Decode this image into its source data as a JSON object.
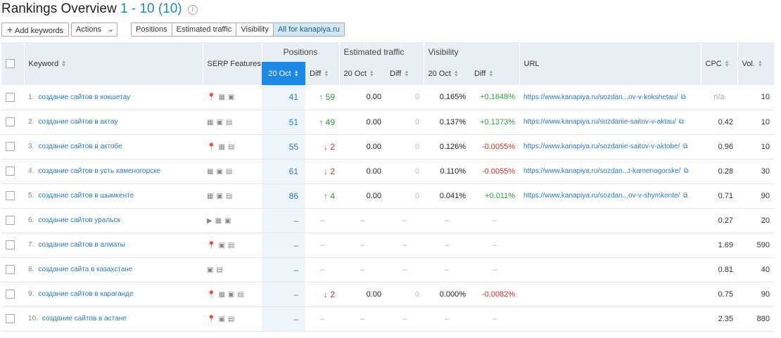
{
  "header": {
    "title": "Rankings Overview",
    "range": "1 - 10 (10)",
    "info_glyph": "i"
  },
  "toolbar": {
    "add_keywords": "Add keywords",
    "actions": "Actions",
    "views": [
      "Positions",
      "Estimated traffic",
      "Visibility",
      "All for kanapiya.ru"
    ],
    "active_view": "All for kanapiya.ru"
  },
  "table": {
    "headers": {
      "keyword": "Keyword",
      "serp": "SERP Features",
      "positions": "Positions",
      "est_traffic": "Estimated traffic",
      "visibility": "Visibility",
      "url": "URL",
      "cpc": "CPC",
      "vol": "Vol.",
      "date": "20 Oct",
      "diff": "Diff"
    },
    "rows": [
      {
        "n": "1.",
        "kw": "создание сайтов в кокшетау",
        "serp": "📍▦▣",
        "pos": "41",
        "pdiff": "↑ 59",
        "pdir": "up",
        "traffic": "0.00",
        "tdiff": "0",
        "vis": "0.165%",
        "vdiff": "+0.1648%",
        "vdir": "up",
        "url": "https://www.kanapiya.ru/sozdan...ov-v-kokshetau/",
        "cpc": "n/a",
        "vol": "10"
      },
      {
        "n": "2.",
        "kw": "создание сайтов в актау",
        "serp": "▦▣▤",
        "pos": "51",
        "pdiff": "↑ 49",
        "pdir": "up",
        "traffic": "0.00",
        "tdiff": "0",
        "vis": "0.137%",
        "vdiff": "+0.1373%",
        "vdir": "up",
        "url": "https://www.kanapiya.ru/sozdanie-saitov-v-aktau/",
        "cpc": "0.42",
        "vol": "10"
      },
      {
        "n": "3.",
        "kw": "создание сайтов в актобе",
        "serp": "📍▦▤",
        "pos": "55",
        "pdiff": "↓ 2",
        "pdir": "down",
        "traffic": "0.00",
        "tdiff": "0",
        "vis": "0.126%",
        "vdiff": "-0.0055%",
        "vdir": "down",
        "url": "https://www.kanapiya.ru/sozdanie-saitov-v-aktobe/",
        "cpc": "0.96",
        "vol": "10"
      },
      {
        "n": "4.",
        "kw": "создание сайтов в усть каменогорске",
        "serp": "▦▣▤",
        "pos": "61",
        "pdiff": "↓ 2",
        "pdir": "down",
        "traffic": "0.00",
        "tdiff": "0",
        "vis": "0.110%",
        "vdiff": "-0.0055%",
        "vdir": "down",
        "url": "https://www.kanapiya.ru/sozdan...t-kamenogorske/",
        "cpc": "0.28",
        "vol": "30"
      },
      {
        "n": "5.",
        "kw": "создание сайтов в шымкенте",
        "serp": "▦▣▤",
        "pos": "86",
        "pdiff": "↑ 4",
        "pdir": "up",
        "traffic": "0.00",
        "tdiff": "0",
        "vis": "0.041%",
        "vdiff": "+0.011%",
        "vdir": "up",
        "url": "https://www.kanapiya.ru/sozdan...ov-v-shymkente/",
        "cpc": "0.71",
        "vol": "90"
      },
      {
        "n": "6.",
        "kw": "создание сайтов уральск",
        "serp": "▶▦▣",
        "pos": "–",
        "pdiff": "–",
        "pdir": "none",
        "traffic": "–",
        "tdiff": "–",
        "vis": "–",
        "vdiff": "–",
        "vdir": "none",
        "url": "",
        "cpc": "0.27",
        "vol": "20"
      },
      {
        "n": "7.",
        "kw": "создание сайтов в алматы",
        "serp": "📍▣▤",
        "pos": "–",
        "pdiff": "–",
        "pdir": "none",
        "traffic": "–",
        "tdiff": "–",
        "vis": "–",
        "vdiff": "–",
        "vdir": "none",
        "url": "",
        "cpc": "1.69",
        "vol": "590"
      },
      {
        "n": "8.",
        "kw": "создание сайта в казахстане",
        "serp": "▣▤",
        "pos": "–",
        "pdiff": "–",
        "pdir": "none",
        "traffic": "–",
        "tdiff": "–",
        "vis": "–",
        "vdiff": "–",
        "vdir": "none",
        "url": "",
        "cpc": "0.81",
        "vol": "40"
      },
      {
        "n": "9.",
        "kw": "создание сайтов в караганде",
        "serp": "📍▦▣▤",
        "pos": "–",
        "pdiff": "↓ 2",
        "pdir": "down",
        "traffic": "0.00",
        "tdiff": "0",
        "vis": "0.000%",
        "vdiff": "-0.0082%",
        "vdir": "down",
        "url": "",
        "cpc": "0.75",
        "vol": "90"
      },
      {
        "n": "10.",
        "kw": "создание сайтов в астане",
        "serp": "📍▣▤",
        "pos": "–",
        "pdiff": "–",
        "pdir": "none",
        "traffic": "–",
        "tdiff": "–",
        "vis": "–",
        "vdiff": "–",
        "vdir": "none",
        "url": "",
        "cpc": "2.35",
        "vol": "880"
      }
    ]
  },
  "colors": {
    "link": "#2a7cc4",
    "accent": "#1e88e5",
    "up": "#2e9e3b",
    "down": "#d93025"
  }
}
